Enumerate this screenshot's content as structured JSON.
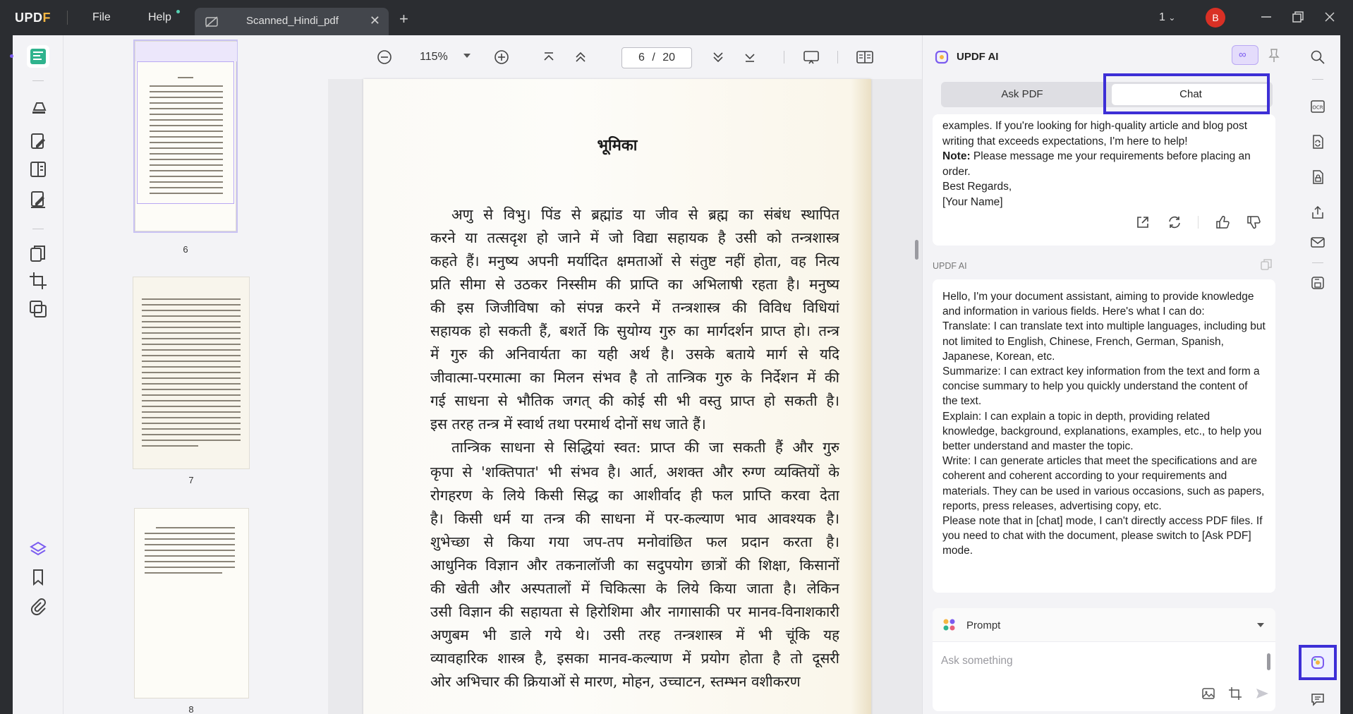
{
  "titlebar": {
    "logo": "UPDF",
    "menu_file": "File",
    "menu_help": "Help",
    "tab_title": "Scanned_Hindi_pdf",
    "page_count": "1",
    "avatar_letter": "B"
  },
  "toolbar": {
    "zoom": "115%",
    "current_page": "6",
    "page_separator": "/",
    "total_pages": "20"
  },
  "thumbnails": [
    {
      "number": "6",
      "active": true
    },
    {
      "number": "7",
      "active": false
    },
    {
      "number": "8",
      "active": false
    }
  ],
  "page": {
    "heading": "भूमिका",
    "lines": [
      "अणु से विभु। पिंड से ब्रह्मांड या जीव से ब्रह्म का संबंध स्थापित",
      "करने या तत्सदृश हो जाने में जो विद्या सहायक है उसी को तन्त्रशास्त्र",
      "कहते हैं। मनुष्य अपनी मर्यादित क्षमताओं से संतुष्ट नहीं होता, वह नित्य",
      "प्रति सीमा से उठकर निस्सीम की प्राप्ति का अभिलाषी रहता है। मनुष्य",
      "की इस जिजीविषा को संपन्न करने में तन्त्रशास्त्र की विविध विधियां",
      "सहायक हो सकती हैं, बशर्ते कि सुयोग्य गुरु का मार्गदर्शन प्राप्त हो। तन्त्र",
      "में गुरु की अनिवार्यता का यही अर्थ है। उसके बताये मार्ग से यदि",
      "जीवात्मा-परमात्मा का मिलन संभव है तो तान्त्रिक गुरु के निर्देशन में की",
      "गई साधना से भौतिक जगत् की कोई सी भी वस्तु प्राप्त हो सकती है।",
      "इस तरह तन्त्र में स्वार्थ तथा परमार्थ दोनों सध जाते हैं।",
      "तान्त्रिक साधना से सिद्धियां स्वत: प्राप्त की जा सकती हैं और गुरु",
      "कृपा से 'शक्तिपात' भी संभव है। आर्त, अशक्त और रुग्ण व्यक्तियों के",
      "रोगहरण के लिये किसी सिद्ध का आशीर्वाद ही फल प्राप्ति करवा देता",
      "है। किसी धर्म या तन्त्र की साधना में पर-कल्याण भाव आवश्यक है।",
      "शुभेच्छा से किया गया जप-तप मनोवांछित फल प्रदान करता है।",
      "आधुनिक विज्ञान और तकनालॉजी का सदुपयोग छात्रों की शिक्षा, किसानों",
      "की खेती और अस्पतालों में चिकित्सा के लिये किया जाता है। लेकिन",
      "उसी विज्ञान की सहायता से हिरोशिमा और नागासाकी पर मानव-विनाशकारी",
      "अणुबम भी डाले गये थे। उसी तरह तन्त्रशास्त्र में भी चूंकि यह",
      "व्यावहारिक शास्त्र है, इसका मानव-कल्याण में प्रयोग होता है तो दूसरी",
      "ओर अभिचार की क्रियाओं से मारण, मोहन, उच्चाटन, स्तम्भन वशीकरण"
    ]
  },
  "ai": {
    "title": "UPDF AI",
    "tab_ask": "Ask PDF",
    "tab_chat": "Chat",
    "message1": {
      "line1": "examples. If you're looking for high-quality article and blog post writing that exceeds expectations, I'm here to help!",
      "note_label": "Note:",
      "note_text": " Please message me your requirements before placing an order.",
      "regards": "Best Regards,",
      "name": "[Your Name]"
    },
    "sender_label": "UPDF AI",
    "message2": [
      "Hello, I'm your document assistant, aiming to provide knowledge and information in various fields. Here's what I can do:",
      "Translate: I can translate text into multiple languages, including but not limited to English, Chinese, French, German, Spanish, Japanese, Korean, etc.",
      "Summarize: I can extract key information from the text and form a concise summary to help you quickly understand the content of the text.",
      "Explain: I can explain a topic in depth, providing related knowledge, background, explanations, examples, etc., to help you better understand and master the topic.",
      "Write: I can generate articles that meet the specifications and are coherent and coherent according to your requirements and materials. They can be used in various occasions, such as papers, reports, press releases, advertising copy, etc.",
      "Please note that in [chat] mode, I can't directly access PDF files. If you need to chat with the document, please switch to [Ask PDF] mode."
    ],
    "prompt_label": "Prompt",
    "input_placeholder": "Ask something"
  },
  "colors": {
    "accent": "#7b5cf0",
    "highlight": "#3d2fd6",
    "titlebar": "#2b2d31"
  }
}
